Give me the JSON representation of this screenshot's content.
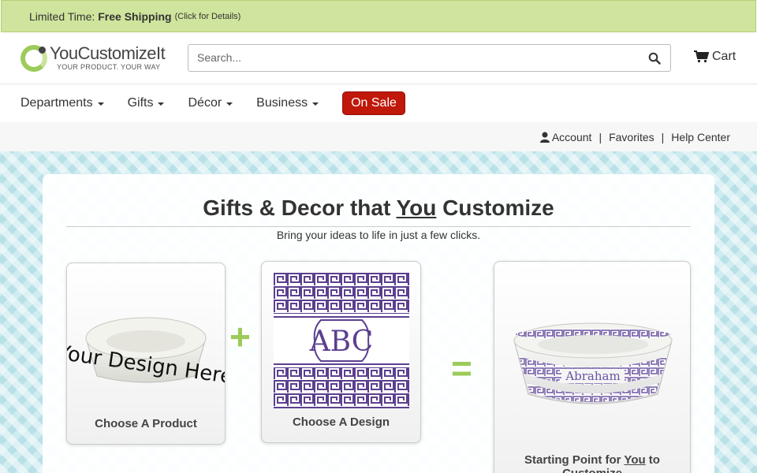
{
  "promo": {
    "prefix": "Limited Time:",
    "highlight": "Free Shipping",
    "details": "(Click for Details)"
  },
  "header": {
    "logo_name": "YouCustomizeIt",
    "logo_tagline": "YOUR PRODUCT. YOUR WAY",
    "search_placeholder": "Search...",
    "cart_label": "Cart"
  },
  "nav": {
    "items": [
      {
        "label": "Departments"
      },
      {
        "label": "Gifts"
      },
      {
        "label": "Décor"
      },
      {
        "label": "Business"
      }
    ],
    "sale_label": "On Sale"
  },
  "utility": {
    "account": "Account",
    "favorites": "Favorites",
    "help": "Help Center"
  },
  "hero": {
    "title_pre": "Gifts & Decor that ",
    "title_you": "You",
    "title_post": " Customize",
    "subtitle": "Bring your ideas to life in just a few clicks.",
    "card1_label": "Choose A Product",
    "card1_image_text": "Your Design Here",
    "card2_label": "Choose A Design",
    "card2_monogram": "ABC",
    "card3_label_pre": "Starting Point for ",
    "card3_label_you": "You",
    "card3_label_post": " to Customize",
    "card3_name": "Abraham",
    "plus": "+",
    "equals": "="
  },
  "colors": {
    "promo_bg": "#cfe49c",
    "accent_green": "#9ccb5a",
    "sale_red": "#c0180b",
    "purple": "#5b3f8f"
  }
}
